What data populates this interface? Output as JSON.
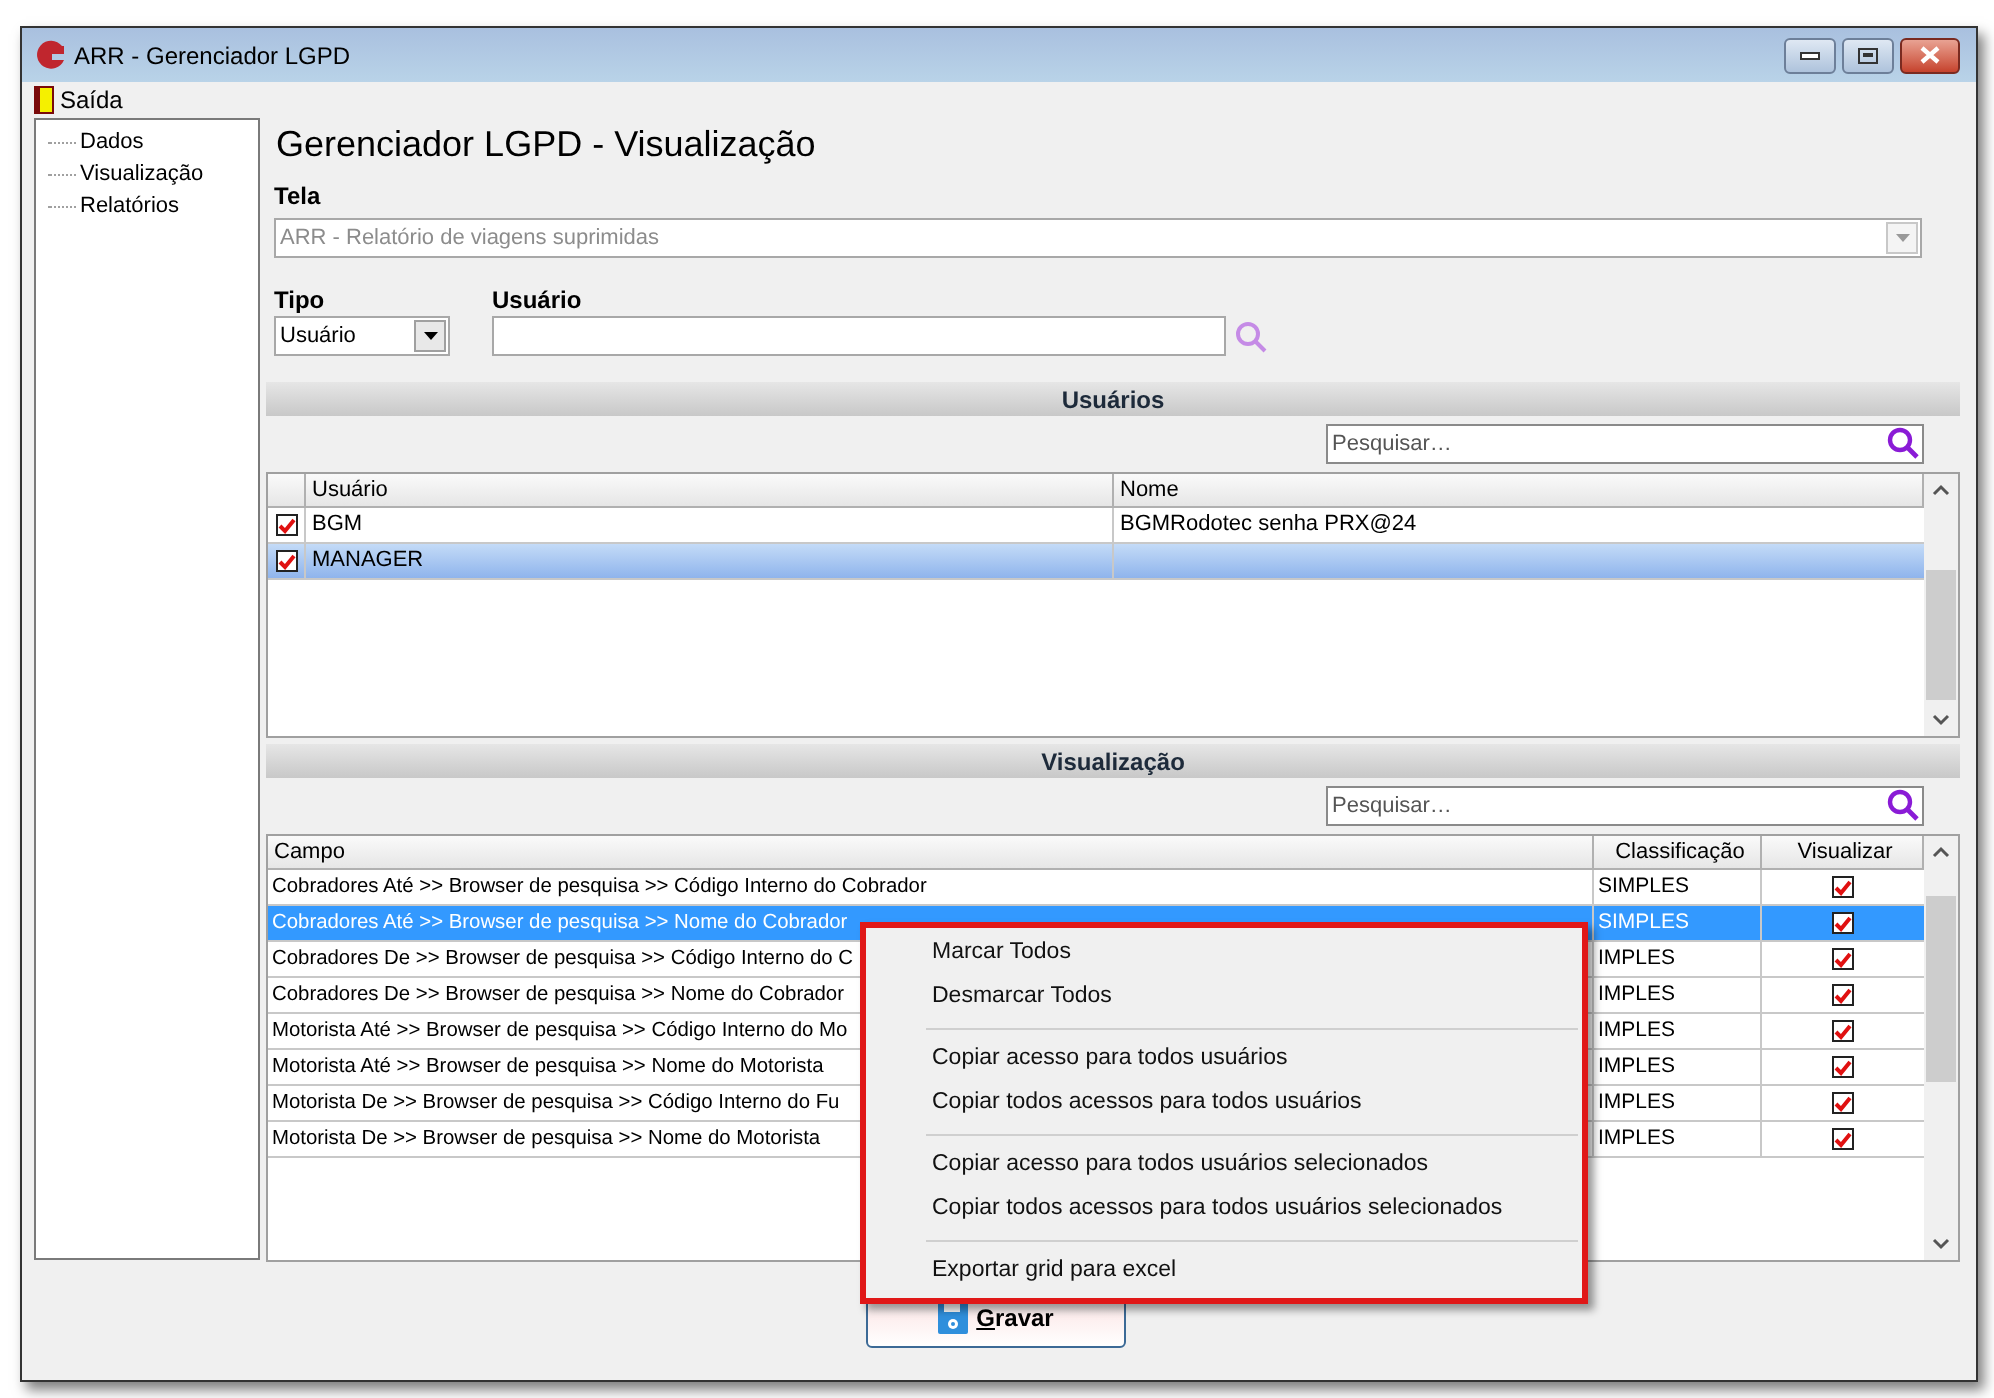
{
  "window": {
    "title": "ARR - Gerenciador LGPD"
  },
  "menu_bar": [
    {
      "label": "Saída"
    }
  ],
  "sidebar": {
    "items": [
      {
        "label": "Dados"
      },
      {
        "label": "Visualização"
      },
      {
        "label": "Relatórios"
      }
    ]
  },
  "heading": "Gerenciador LGPD - Visualização",
  "tela": {
    "label": "Tela",
    "value": "ARR - Relatório de viagens suprimidas",
    "disabled": true
  },
  "tipo": {
    "label": "Tipo",
    "value": "Usuário"
  },
  "usuario": {
    "label": "Usuário"
  },
  "users_section": {
    "title": "Usuários",
    "search": {
      "placeholder": "Pesquisar…"
    },
    "columns": [
      "Usuário",
      "Nome"
    ],
    "rows": [
      {
        "checked": true,
        "selected": false,
        "usuario": "BGM",
        "nome": "BGMRodotec senha PRX@24"
      },
      {
        "checked": true,
        "selected": true,
        "usuario": "MANAGER"
      }
    ]
  },
  "view_section": {
    "title": "Visualização",
    "search": {
      "placeholder": "Pesquisar…"
    },
    "columns": [
      "Campo",
      "Classificação",
      "Visualizar"
    ],
    "rows": [
      {
        "campo": "Cobradores Até >> Browser de pesquisa >> Código Interno do Cobrador",
        "classificacao": "SIMPLES",
        "visualizar": true,
        "selected": false
      },
      {
        "campo": "Cobradores Até >> Browser de pesquisa >> Nome do Cobrador",
        "classificacao": "SIMPLES",
        "visualizar": true,
        "selected": true
      },
      {
        "campo": "Cobradores De >> Browser de pesquisa >> Código Interno do C",
        "classificacao": "IMPLES",
        "visualizar": true,
        "selected": false
      },
      {
        "campo": "Cobradores De >> Browser de pesquisa >> Nome do Cobrador",
        "classificacao": "IMPLES",
        "visualizar": true,
        "selected": false
      },
      {
        "campo": "Motorista Até >> Browser de pesquisa >> Código Interno do Mo",
        "classificacao": "IMPLES",
        "visualizar": true,
        "selected": false
      },
      {
        "campo": "Motorista Até >> Browser de pesquisa >> Nome do Motorista",
        "classificacao": "IMPLES",
        "visualizar": true,
        "selected": false
      },
      {
        "campo": "Motorista De >> Browser de pesquisa >> Código Interno do Fu",
        "classificacao": "IMPLES",
        "visualizar": true,
        "selected": false
      },
      {
        "campo": "Motorista De >> Browser de pesquisa >> Nome do Motorista",
        "classificacao": "IMPLES",
        "visualizar": true,
        "selected": false
      }
    ]
  },
  "context_menu": {
    "items": [
      {
        "kind": "item",
        "label": "Marcar Todos"
      },
      {
        "kind": "item",
        "label": "Desmarcar Todos"
      },
      {
        "kind": "separator"
      },
      {
        "kind": "item",
        "label": "Copiar acesso para todos usuários"
      },
      {
        "kind": "item",
        "label": "Copiar todos acessos para todos usuários"
      },
      {
        "kind": "separator"
      },
      {
        "kind": "item",
        "label": "Copiar acesso para todos usuários selecionados"
      },
      {
        "kind": "item",
        "label": "Copiar todos acessos para todos usuários selecionados"
      },
      {
        "kind": "separator"
      },
      {
        "kind": "item",
        "label": "Exportar grid para excel"
      }
    ]
  },
  "save_button": {
    "label": "Gravar"
  }
}
